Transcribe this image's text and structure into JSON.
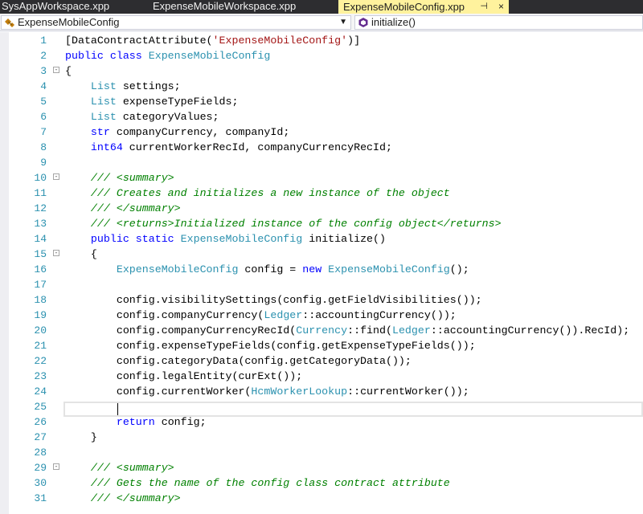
{
  "tabs": [
    {
      "label": "SysAppWorkspace.xpp",
      "active": false
    },
    {
      "label": "ExpenseMobileWorkspace.xpp",
      "active": false
    },
    {
      "label": "ExpenseMobileConfig.xpp",
      "active": true
    }
  ],
  "active_tab_pin": "⊣",
  "active_tab_close": "×",
  "navbar": {
    "class_combo": "ExpenseMobileConfig",
    "member_combo": "initialize()"
  },
  "code_lines": [
    {
      "n": "1",
      "tokens": [
        [
          "p",
          "[DataContractAttribute("
        ],
        [
          "s",
          "'ExpenseMobileConfig'"
        ],
        [
          "p",
          ")]"
        ]
      ]
    },
    {
      "n": "2",
      "tokens": [
        [
          "k",
          "public class "
        ],
        [
          "t",
          "ExpenseMobileConfig"
        ]
      ]
    },
    {
      "n": "3",
      "tokens": [
        [
          "p",
          "{"
        ]
      ],
      "fold": "-"
    },
    {
      "n": "4",
      "tokens": [
        [
          "p",
          "    "
        ],
        [
          "t",
          "List"
        ],
        [
          "p",
          " settings;"
        ]
      ]
    },
    {
      "n": "5",
      "tokens": [
        [
          "p",
          "    "
        ],
        [
          "t",
          "List"
        ],
        [
          "p",
          " expenseTypeFields;"
        ]
      ]
    },
    {
      "n": "6",
      "tokens": [
        [
          "p",
          "    "
        ],
        [
          "t",
          "List"
        ],
        [
          "p",
          " categoryValues;"
        ]
      ]
    },
    {
      "n": "7",
      "tokens": [
        [
          "p",
          "    "
        ],
        [
          "k",
          "str"
        ],
        [
          "p",
          " companyCurrency, companyId;"
        ]
      ]
    },
    {
      "n": "8",
      "tokens": [
        [
          "p",
          "    "
        ],
        [
          "k",
          "int64"
        ],
        [
          "p",
          " currentWorkerRecId, companyCurrencyRecId;"
        ]
      ]
    },
    {
      "n": "9",
      "tokens": [
        [
          "p",
          ""
        ]
      ]
    },
    {
      "n": "10",
      "tokens": [
        [
          "p",
          "    "
        ],
        [
          "c",
          "/// <summary>"
        ]
      ],
      "fold": "-"
    },
    {
      "n": "11",
      "tokens": [
        [
          "p",
          "    "
        ],
        [
          "c",
          "/// Creates and initializes a new instance of the object"
        ]
      ]
    },
    {
      "n": "12",
      "tokens": [
        [
          "p",
          "    "
        ],
        [
          "c",
          "/// </summary>"
        ]
      ]
    },
    {
      "n": "13",
      "tokens": [
        [
          "p",
          "    "
        ],
        [
          "c",
          "/// <returns>Initialized instance of the config object</returns>"
        ]
      ]
    },
    {
      "n": "14",
      "tokens": [
        [
          "p",
          "    "
        ],
        [
          "k",
          "public static "
        ],
        [
          "t",
          "ExpenseMobileConfig"
        ],
        [
          "p",
          " initialize()"
        ]
      ]
    },
    {
      "n": "15",
      "tokens": [
        [
          "p",
          "    {"
        ]
      ],
      "fold": "-"
    },
    {
      "n": "16",
      "tokens": [
        [
          "p",
          "        "
        ],
        [
          "t",
          "ExpenseMobileConfig"
        ],
        [
          "p",
          " config = "
        ],
        [
          "k",
          "new "
        ],
        [
          "t",
          "ExpenseMobileConfig"
        ],
        [
          "p",
          "();"
        ]
      ]
    },
    {
      "n": "17",
      "tokens": [
        [
          "p",
          ""
        ]
      ]
    },
    {
      "n": "18",
      "tokens": [
        [
          "p",
          "        config.visibilitySettings(config.getFieldVisibilities());"
        ]
      ]
    },
    {
      "n": "19",
      "tokens": [
        [
          "p",
          "        config.companyCurrency("
        ],
        [
          "t",
          "Ledger"
        ],
        [
          "p",
          "::accountingCurrency());"
        ]
      ]
    },
    {
      "n": "20",
      "tokens": [
        [
          "p",
          "        config.companyCurrencyRecId("
        ],
        [
          "t",
          "Currency"
        ],
        [
          "p",
          "::find("
        ],
        [
          "t",
          "Ledger"
        ],
        [
          "p",
          "::accountingCurrency()).RecId);"
        ]
      ]
    },
    {
      "n": "21",
      "tokens": [
        [
          "p",
          "        config.expenseTypeFields(config.getExpenseTypeFields());"
        ]
      ]
    },
    {
      "n": "22",
      "tokens": [
        [
          "p",
          "        config.categoryData(config.getCategoryData());"
        ]
      ]
    },
    {
      "n": "23",
      "tokens": [
        [
          "p",
          "        config.legalEntity(curExt());"
        ]
      ]
    },
    {
      "n": "24",
      "tokens": [
        [
          "p",
          "        config.currentWorker("
        ],
        [
          "t",
          "HcmWorkerLookup"
        ],
        [
          "p",
          "::currentWorker());"
        ]
      ]
    },
    {
      "n": "25",
      "tokens": [
        [
          "p",
          ""
        ]
      ]
    },
    {
      "n": "26",
      "tokens": [
        [
          "p",
          "        "
        ],
        [
          "k",
          "return"
        ],
        [
          "p",
          " config;"
        ]
      ]
    },
    {
      "n": "27",
      "tokens": [
        [
          "p",
          "    }"
        ]
      ]
    },
    {
      "n": "28",
      "tokens": [
        [
          "p",
          ""
        ]
      ]
    },
    {
      "n": "29",
      "tokens": [
        [
          "p",
          "    "
        ],
        [
          "c",
          "/// <summary>"
        ]
      ],
      "fold": "-"
    },
    {
      "n": "30",
      "tokens": [
        [
          "p",
          "    "
        ],
        [
          "c",
          "/// Gets the name of the config class contract attribute"
        ]
      ]
    },
    {
      "n": "31",
      "tokens": [
        [
          "p",
          "    "
        ],
        [
          "c",
          "/// </summary>"
        ]
      ]
    }
  ],
  "current_line": "25",
  "colors": {
    "keyword": "#0000ff",
    "type": "#2b91af",
    "string": "#a31515",
    "comment": "#008000",
    "tab_active": "#fff29d",
    "tab_bar": "#2d2d30"
  }
}
